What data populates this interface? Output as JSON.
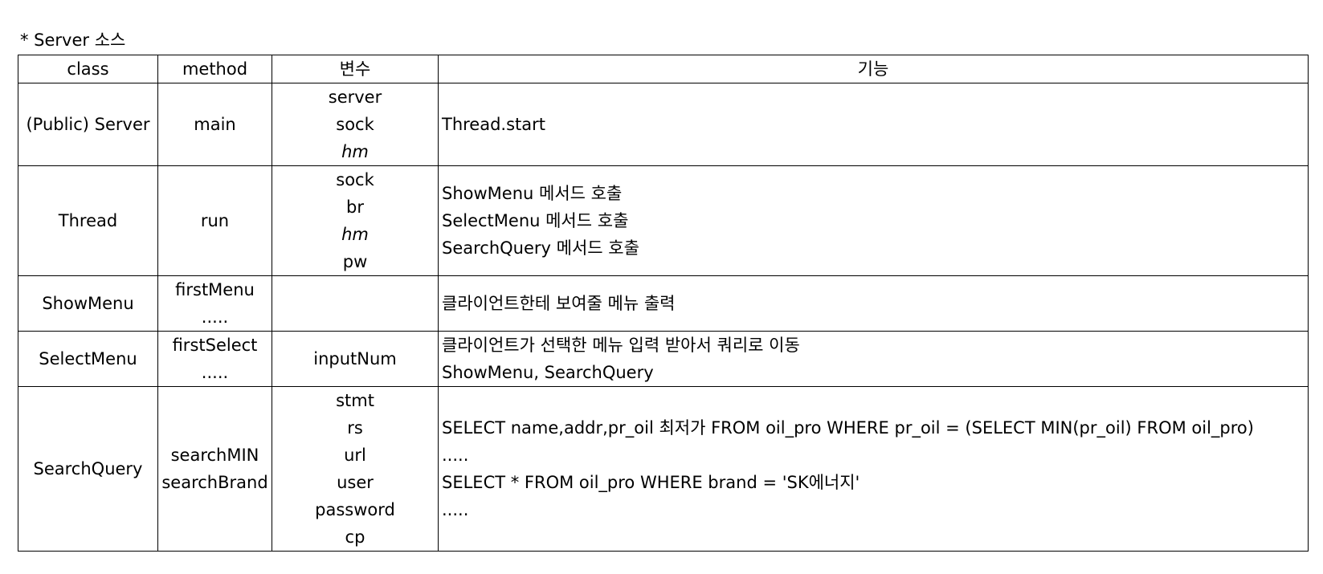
{
  "caption": "* Server 소스",
  "headers": {
    "class": "class",
    "method": "method",
    "vars": "변수",
    "func": "기능"
  },
  "rows": [
    {
      "class": "(Public) Server",
      "methods": [
        "main"
      ],
      "vars": [
        "server",
        "sock",
        "hm"
      ],
      "func": [
        "Thread.start"
      ]
    },
    {
      "class": "Thread",
      "methods": [
        "run"
      ],
      "vars": [
        "sock",
        "br",
        "hm",
        "pw"
      ],
      "func": [
        "ShowMenu 메서드 호출",
        "SelectMenu 메서드 호출",
        "SearchQuery 메서드 호출"
      ]
    },
    {
      "class": "ShowMenu",
      "methods": [
        "firstMenu",
        "....."
      ],
      "vars": [],
      "func": [
        "클라이언트한테 보여줄 메뉴 출력"
      ]
    },
    {
      "class": "SelectMenu",
      "methods": [
        "firstSelect",
        "....."
      ],
      "vars": [
        "inputNum"
      ],
      "func": [
        "클라이언트가 선택한 메뉴 입력 받아서 쿼리로 이동",
        "ShowMenu, SearchQuery"
      ]
    },
    {
      "class": "SearchQuery",
      "methods": [
        "searchMIN",
        "searchBrand"
      ],
      "vars": [
        "stmt",
        "rs",
        "url",
        "user",
        "password",
        "cp"
      ],
      "func": [
        "SELECT name,addr,pr_oil 최저가 FROM oil_pro WHERE pr_oil = (SELECT MIN(pr_oil) FROM oil_pro)",
        ".....",
        "SELECT * FROM oil_pro WHERE brand = 'SK에너지'",
        "....."
      ]
    }
  ]
}
